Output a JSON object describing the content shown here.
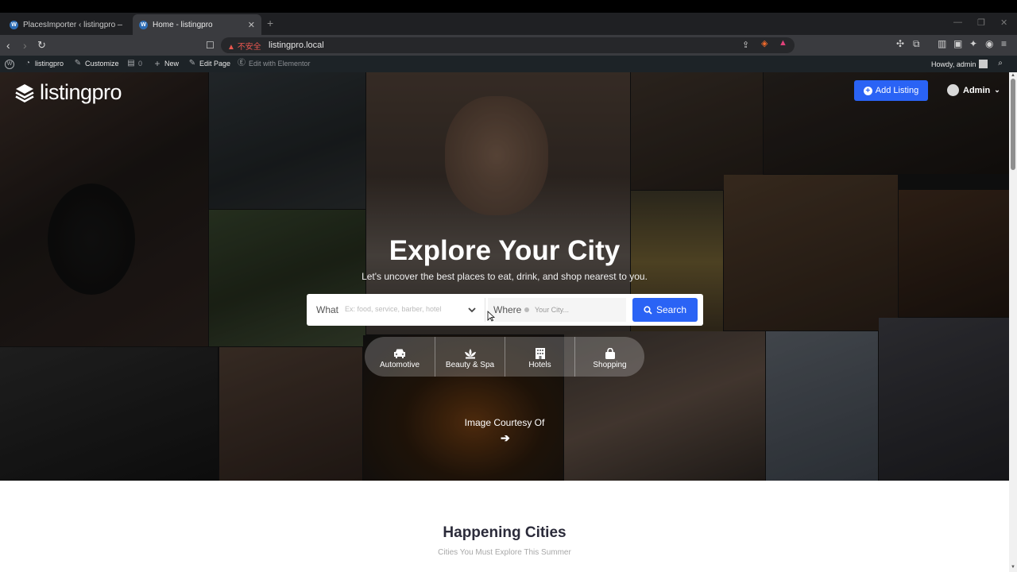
{
  "browser": {
    "tabs": [
      {
        "label": "PlacesImporter ‹ listingpro — Wor",
        "active": false
      },
      {
        "label": "Home - listingpro",
        "active": true
      }
    ],
    "security_warning": "不安全",
    "url": "listingpro.local"
  },
  "wp_admin_bar": {
    "site": "listingpro",
    "customize": "Customize",
    "comments": "0",
    "new": "New",
    "edit_page": "Edit Page",
    "elementor": "Edit with Elementor",
    "howdy": "Howdy, admin"
  },
  "header": {
    "logo_text": "listingpro",
    "add_listing": "Add Listing",
    "user": "Admin"
  },
  "hero": {
    "title": "Explore Your City",
    "subtitle": "Let's uncover the best places to eat, drink, and shop nearest to you.",
    "search": {
      "what_label": "What",
      "what_placeholder": "Ex: food, service, barber, hotel",
      "where_label": "Where",
      "where_placeholder": "Your City...",
      "button": "Search"
    },
    "categories": [
      {
        "label": "Automotive",
        "icon": "car-icon"
      },
      {
        "label": "Beauty & Spa",
        "icon": "lotus-icon"
      },
      {
        "label": "Hotels",
        "icon": "building-icon"
      },
      {
        "label": "Shopping",
        "icon": "bag-icon"
      }
    ],
    "courtesy": "Image Courtesy Of"
  },
  "section": {
    "title": "Happening Cities",
    "subtitle": "Cities You Must Explore This Summer"
  },
  "colors": {
    "accent": "#2a63f5",
    "wp_bar": "#1d2327",
    "browser_bar": "#3a3b3f"
  }
}
